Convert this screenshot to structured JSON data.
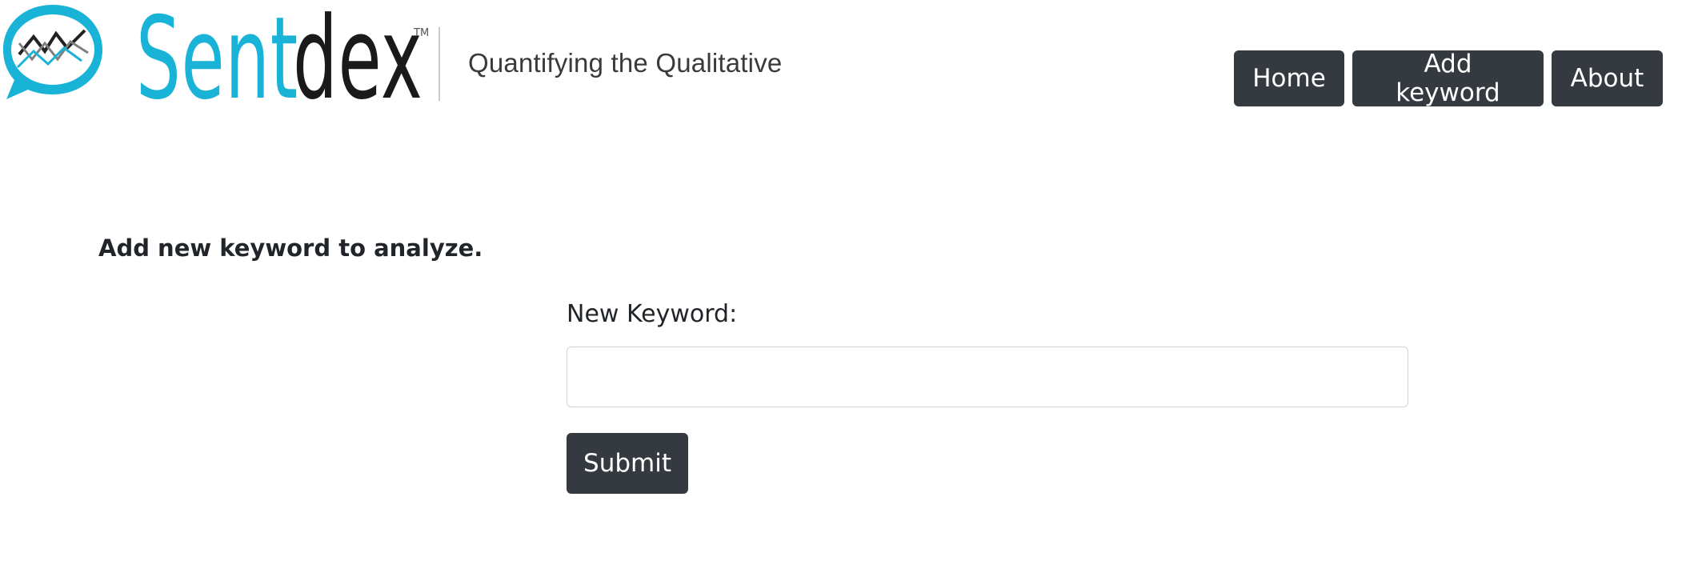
{
  "brand": {
    "name_part1": "Sent",
    "name_part2": "dex",
    "trademark": "TM",
    "tagline": "Quantifying the Qualitative",
    "colors": {
      "primary": "#1ab3d8",
      "dark": "#1a1a1a"
    },
    "icon": "chart-speech-bubble-logo"
  },
  "nav": {
    "items": [
      {
        "label": "Home"
      },
      {
        "label": "Add keyword"
      },
      {
        "label": "About"
      }
    ],
    "button_color": "#343a40"
  },
  "main": {
    "heading": "Add new keyword to analyze.",
    "form": {
      "label": "New Keyword:",
      "input_value": "",
      "input_placeholder": "",
      "submit_label": "Submit"
    }
  }
}
